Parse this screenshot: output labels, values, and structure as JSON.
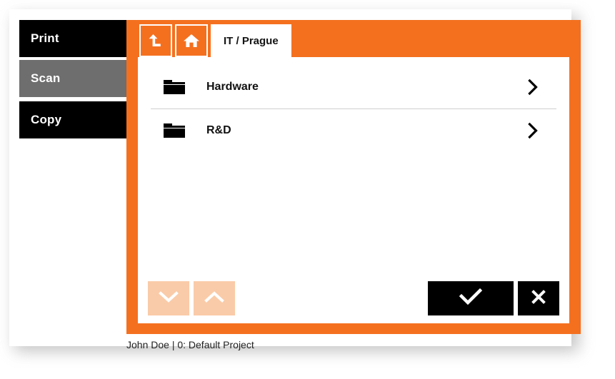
{
  "theme": {
    "accent": "#f4701f",
    "accent_light": "#facba8",
    "black": "#000000",
    "selected_gray": "#6e6e6e",
    "divider": "#cfcfcf"
  },
  "sidebar": {
    "items": [
      {
        "label": "Print",
        "state": "normal",
        "icon": "print-icon"
      },
      {
        "label": "Scan",
        "state": "selected",
        "icon": "scan-icon"
      },
      {
        "label": "Copy",
        "state": "normal",
        "icon": "copy-icon"
      }
    ]
  },
  "tabbar": {
    "up_button": {
      "icon": "arrow-up-level-icon",
      "label": "Up one level"
    },
    "home_button": {
      "icon": "home-icon",
      "label": "Home"
    },
    "active_tab": {
      "label": "IT / Prague"
    }
  },
  "folder_list": {
    "rows": [
      {
        "label": "Hardware",
        "icon": "folder-icon",
        "chevron": "chevron-right-icon"
      },
      {
        "label": "R&D",
        "icon": "folder-icon",
        "chevron": "chevron-right-icon"
      }
    ]
  },
  "button_bar": {
    "page_down": {
      "icon": "chevron-down-icon",
      "label": "Page down",
      "state": "disabled"
    },
    "page_up": {
      "icon": "chevron-up-icon",
      "label": "Page up",
      "state": "disabled"
    },
    "confirm": {
      "icon": "check-icon",
      "label": "OK"
    },
    "cancel": {
      "icon": "close-icon",
      "label": "Cancel"
    }
  },
  "statusbar": {
    "text": "John Doe | 0: Default Project"
  }
}
